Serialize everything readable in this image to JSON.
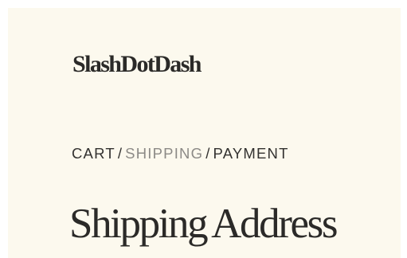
{
  "brand": {
    "name": "SlashDotDash"
  },
  "breadcrumb": {
    "items": [
      {
        "label": "CART",
        "state": "link"
      },
      {
        "label": "SHIPPING",
        "state": "current"
      },
      {
        "label": "PAYMENT",
        "state": "link"
      }
    ],
    "separator": "/"
  },
  "main": {
    "title": "Shipping Address"
  },
  "colors": {
    "background": "#fcf9ee",
    "text": "#2b2a28",
    "muted": "#8c8a86"
  }
}
